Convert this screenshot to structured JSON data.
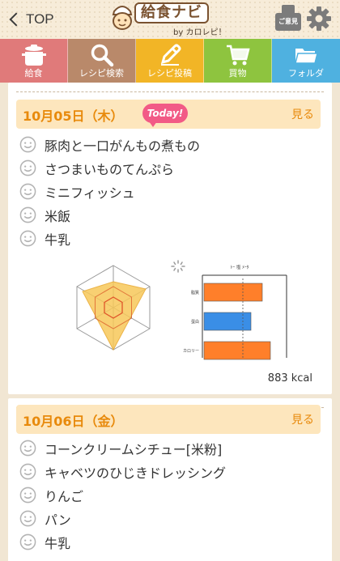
{
  "header": {
    "back_label": "TOP",
    "app_title": "給食ナビ",
    "byline": "by カロレピ！",
    "opinion_label": "ご意見"
  },
  "tabs": [
    {
      "label": "給食",
      "icon": "pot-icon"
    },
    {
      "label": "レシピ検索",
      "icon": "search-icon"
    },
    {
      "label": "レシピ投稿",
      "icon": "pencil-icon"
    },
    {
      "label": "買物",
      "icon": "cart-icon"
    },
    {
      "label": "フォルダ",
      "icon": "folder-icon"
    }
  ],
  "days": [
    {
      "date": "10月05日（木）",
      "badge": "Today!",
      "more": "見る",
      "items": [
        "豚肉と一口がんもの煮もの",
        "さつまいものてんぷら",
        "ミニフィッシュ",
        "米飯",
        "牛乳"
      ],
      "kcal": "883 kcal",
      "balance_chart": {
        "title": "ﾄｰ 塩 ﾒｰﾀ",
        "rows": [
          {
            "label": "脂質",
            "value": 0.72
          },
          {
            "label": "蛋白",
            "value": 0.58
          },
          {
            "label": "カロリー",
            "value": 0.82
          }
        ]
      }
    },
    {
      "date": "10月06日（金）",
      "more": "見る",
      "items": [
        "コーンクリームシチュー[米粉]",
        "キャベツのひじきドレッシング",
        "りんご",
        "パン",
        "牛乳"
      ]
    }
  ],
  "colors": {
    "accent": "#e88a0c",
    "date_bar": "#fde6bd",
    "today_badge": "#f25a86",
    "bar_orange": "#ff7f2a",
    "bar_blue": "#3a8ee6",
    "radar_fill": "#f7c85a"
  }
}
